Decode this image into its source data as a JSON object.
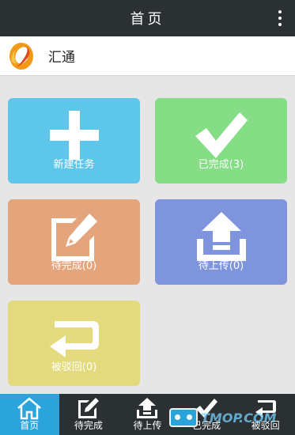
{
  "header": {
    "title": "首页"
  },
  "brand": {
    "name": "汇通"
  },
  "tiles": [
    {
      "label": "新建任务",
      "icon": "plus-icon"
    },
    {
      "label": "已完成(3)",
      "icon": "checkmark-icon"
    },
    {
      "label": "待完成(0)",
      "icon": "edit-icon"
    },
    {
      "label": "待上传(0)",
      "icon": "upload-icon"
    },
    {
      "label": "被驳回(0)",
      "icon": "return-arrow-icon"
    }
  ],
  "bottom_nav": [
    {
      "label": "首页",
      "icon": "home-icon",
      "active": true
    },
    {
      "label": "待完成",
      "icon": "edit-icon",
      "active": false
    },
    {
      "label": "待上传",
      "icon": "upload-icon",
      "active": false
    },
    {
      "label": "已完成",
      "icon": "checkmark-icon",
      "active": false
    },
    {
      "label": "被驳回",
      "icon": "return-arrow-icon",
      "active": false
    }
  ],
  "watermark": {
    "text": "TMOP.COM"
  },
  "colors": {
    "topbar": "#2b3033",
    "tile_new": "#5ec6eb",
    "tile_done": "#85dd86",
    "tile_pending": "#e4a47c",
    "tile_upload": "#7e95dd",
    "tile_rejected": "#e2da7c",
    "nav_active": "#2ba4dc"
  }
}
